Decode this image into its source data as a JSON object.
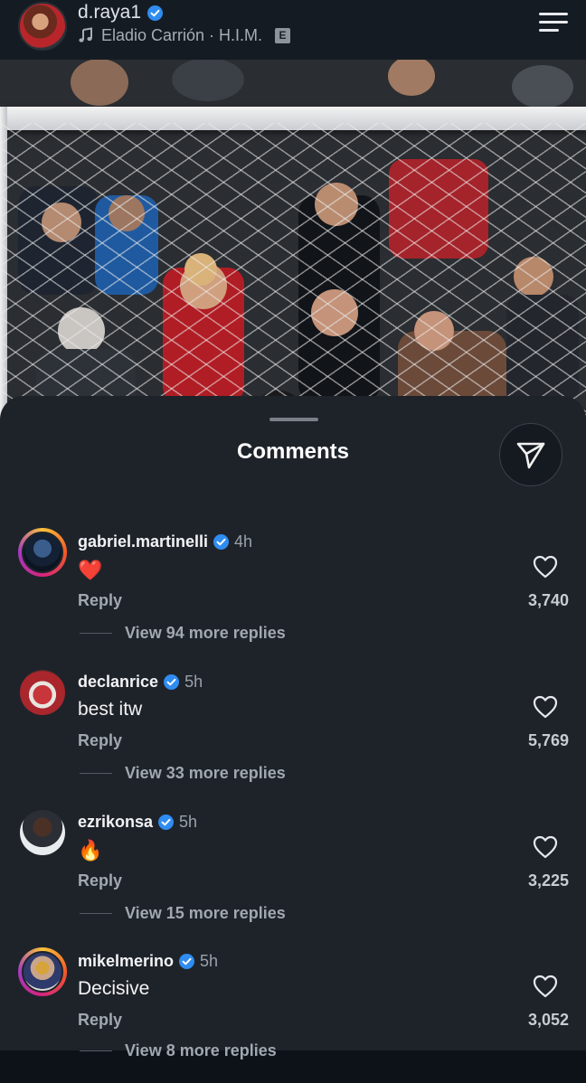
{
  "header": {
    "username": "d.raya1",
    "music": "Eladio Carrión · H.I.M.",
    "explicit_badge": "E"
  },
  "sheet": {
    "title": "Comments"
  },
  "comments": [
    {
      "username": "gabriel.martinelli",
      "time": "4h",
      "text": "❤️",
      "reply_label": "Reply",
      "likes": "3,740",
      "more_replies": "View 94 more replies",
      "has_story_ring": true
    },
    {
      "username": "declanrice",
      "time": "5h",
      "text": "best itw",
      "reply_label": "Reply",
      "likes": "5,769",
      "more_replies": "View 33 more replies",
      "has_story_ring": false
    },
    {
      "username": "ezrikonsa",
      "time": "5h",
      "text": "🔥",
      "reply_label": "Reply",
      "likes": "3,225",
      "more_replies": "View 15 more replies",
      "has_story_ring": false
    },
    {
      "username": "mikelmerino",
      "time": "5h",
      "text": "Decisive",
      "reply_label": "Reply",
      "likes": "3,052",
      "more_replies": "View 8 more replies",
      "has_story_ring": true
    }
  ],
  "icons": {
    "verified": "verified-badge-icon",
    "music": "music-note-icon",
    "menu": "hamburger-menu-icon",
    "share": "paper-plane-icon",
    "like": "heart-outline-icon"
  },
  "colors": {
    "verified_blue": "#2f8cf0",
    "sheet_bg": "#1e232a",
    "heart_red": "#e0242e"
  }
}
